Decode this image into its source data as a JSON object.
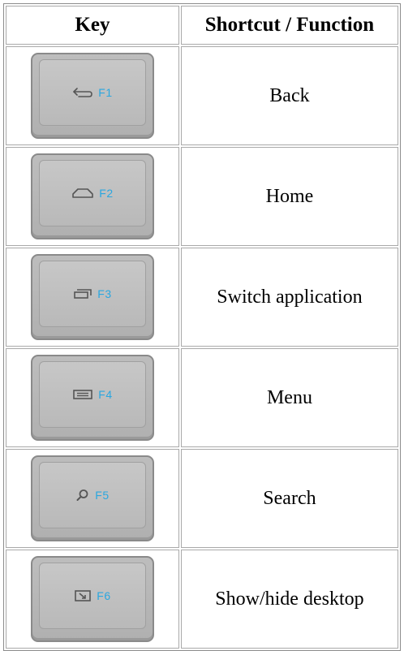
{
  "table": {
    "headers": {
      "key": "Key",
      "function": "Shortcut / Function"
    },
    "rows": [
      {
        "key_label": "F1",
        "icon": "back-arrow-icon",
        "function": "Back"
      },
      {
        "key_label": "F2",
        "icon": "home-icon",
        "function": "Home"
      },
      {
        "key_label": "F3",
        "icon": "switch-app-icon",
        "function": "Switch application"
      },
      {
        "key_label": "F4",
        "icon": "menu-icon",
        "function": "Menu"
      },
      {
        "key_label": "F5",
        "icon": "search-icon",
        "function": "Search"
      },
      {
        "key_label": "F6",
        "icon": "desktop-icon",
        "function": "Show/hide desktop"
      }
    ]
  },
  "colors": {
    "key_label": "#2aa7e0",
    "keycap": "#b8b8b8",
    "icon_stroke": "#555555"
  }
}
